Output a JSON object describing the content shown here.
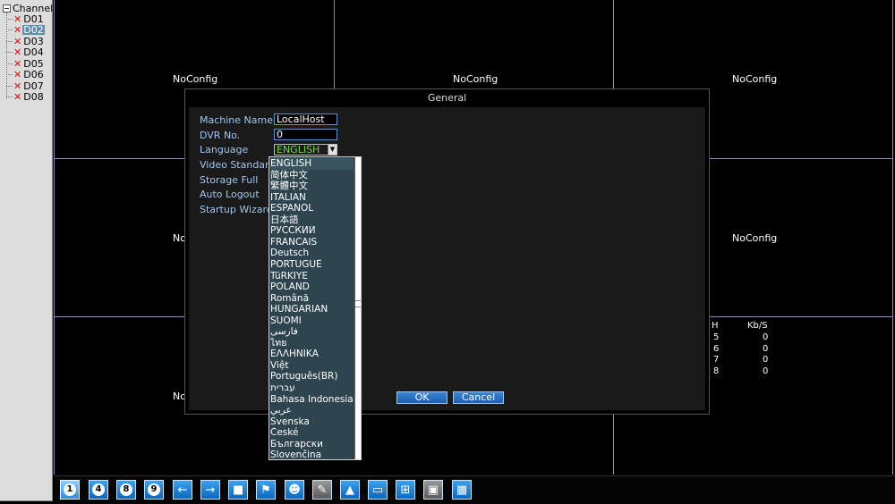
{
  "tree": {
    "root_label": "Channel",
    "channels": [
      {
        "label": "D01",
        "selected": false
      },
      {
        "label": "D02",
        "selected": true
      },
      {
        "label": "D03",
        "selected": false
      },
      {
        "label": "D04",
        "selected": false
      },
      {
        "label": "D05",
        "selected": false
      },
      {
        "label": "D06",
        "selected": false
      },
      {
        "label": "D07",
        "selected": false
      },
      {
        "label": "D08",
        "selected": false
      }
    ]
  },
  "video": {
    "noconfig_text": "NoConfig",
    "partial_text": "No",
    "stats_header": {
      "ch": "H",
      "kbs": "Kb/S"
    },
    "stats_rows": [
      {
        "ch": "5",
        "kbs": "0"
      },
      {
        "ch": "6",
        "kbs": "0"
      },
      {
        "ch": "7",
        "kbs": "0"
      },
      {
        "ch": "8",
        "kbs": "0"
      }
    ]
  },
  "dialog": {
    "title": "General",
    "fields": {
      "machine_name_label": "Machine Name",
      "machine_name_value": "LocalHost",
      "dvr_no_label": "DVR No.",
      "dvr_no_value": "0",
      "language_label": "Language",
      "language_value": "ENGLISH",
      "video_standard_label": "Video Standard",
      "storage_full_label": "Storage Full",
      "auto_logout_label": "Auto Logout",
      "startup_wizard_label": "Startup Wizard"
    },
    "ok_label": "OK",
    "cancel_label": "Cancel"
  },
  "language_options": [
    "ENGLISH",
    "简体中文",
    "繁體中文",
    "ITALIAN",
    "ESPAÑOL",
    "日本語",
    "РУССКИЙ",
    "FRANCAIS",
    "Deutsch",
    "PORTUGUÊ",
    "TüRKİYE",
    "POLAND",
    "Română",
    "HUNGARIAN",
    "SUOMI",
    "فارسی",
    "ไทย",
    "ΕΛΛΗΝΙΚΑ",
    "Việt",
    "Português(BR)",
    "עברית",
    "Bahasa Indonesia",
    "عربي",
    "Svenska",
    "České",
    "Български",
    "Slovenčina"
  ],
  "toolbar": {
    "buttons": [
      {
        "name": "layout-1-button",
        "icon": "layout-1-icon",
        "text": "1"
      },
      {
        "name": "layout-4-button",
        "icon": "layout-4-icon",
        "text": "4"
      },
      {
        "name": "layout-8-button",
        "icon": "layout-8-icon",
        "text": "8"
      },
      {
        "name": "layout-9-button",
        "icon": "layout-9-icon",
        "text": "9"
      },
      {
        "name": "previous-button",
        "icon": "arrow-left-icon",
        "text": "←"
      },
      {
        "name": "next-button",
        "icon": "arrow-right-icon",
        "text": "→"
      },
      {
        "name": "record-button",
        "icon": "record-icon",
        "text": "■"
      },
      {
        "name": "alarm-button",
        "icon": "person-alarm-icon",
        "text": "⚑"
      },
      {
        "name": "user-button",
        "icon": "user-icon",
        "text": "☻"
      },
      {
        "name": "ptz-button",
        "icon": "camera-icon",
        "text": "✎"
      },
      {
        "name": "graph-button",
        "icon": "chart-icon",
        "text": "▲"
      },
      {
        "name": "display-button",
        "icon": "monitor-icon",
        "text": "▭"
      },
      {
        "name": "network-button",
        "icon": "network-icon",
        "text": "⊞"
      },
      {
        "name": "storage-button",
        "icon": "disk-icon",
        "text": "▣"
      },
      {
        "name": "info-button",
        "icon": "qrcode-icon",
        "text": "▦"
      }
    ]
  }
}
